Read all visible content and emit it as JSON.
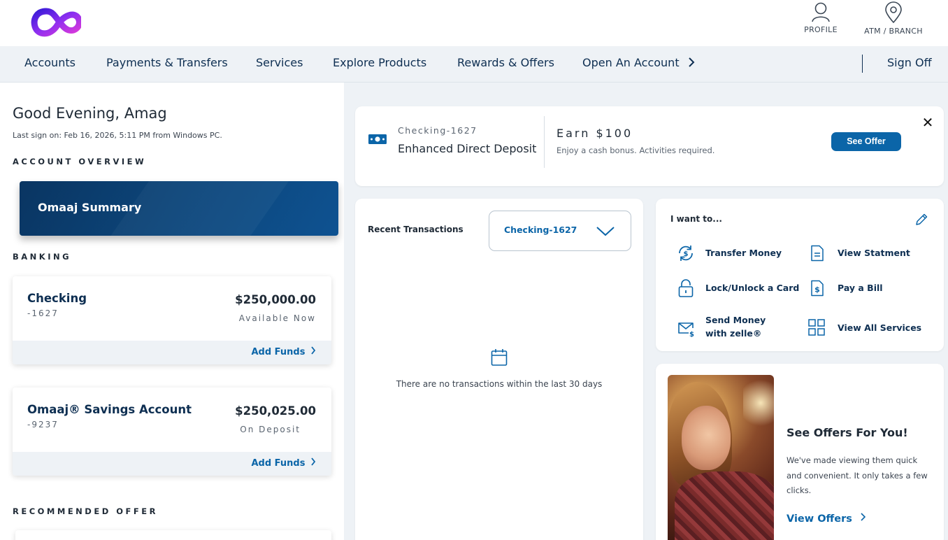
{
  "header": {
    "profile_label": "PROFILE",
    "atm_label": "ATM / BRANCH"
  },
  "nav": {
    "items": [
      "Accounts",
      "Payments & Transfers",
      "Services",
      "Explore Products",
      "Rewards & Offers",
      "Open An Account"
    ],
    "sign_off": "Sign Off"
  },
  "overview": {
    "greeting": "Good Evening, Amag",
    "last_sign_on": "Last sign on: Feb 16, 2026, 5:11 PM from Windows PC.",
    "section_title": "ACCOUNT OVERVIEW",
    "summary_title": "Omaaj Summary",
    "banking_title": "BANKING",
    "accounts": [
      {
        "name": "Checking",
        "number": "-1627",
        "balance": "$250,000.00",
        "status": "Available Now",
        "action": "Add Funds"
      },
      {
        "name": "Omaaj® Savings Account",
        "number": "-9237",
        "balance": "$250,025.00",
        "status": "On Deposit",
        "action": "Add Funds"
      }
    ],
    "recommended_title": "RECOMMENDED OFFER"
  },
  "promo": {
    "account": "Checking-1627",
    "title": "Enhanced Direct Deposit",
    "headline": "Earn $100",
    "description": "Enjoy a cash bonus. Activities required.",
    "button": "See Offer",
    "close": "✕"
  },
  "recent": {
    "title": "Recent Transactions",
    "selected_account": "Checking-1627",
    "empty_message": "There are no transactions within the last 30 days"
  },
  "want": {
    "title": "I want to...",
    "items": [
      "Transfer Money",
      "View Statment",
      "Lock/Unlock a Card",
      "Pay a Bill",
      "Send Money with zelle®",
      "View All Services"
    ]
  },
  "offers": {
    "title": "See Offers For You!",
    "text": "We've made viewing them quick and convenient. It only takes a few clicks.",
    "link": "View Offers"
  },
  "colors": {
    "brand_blue": "#0b65a8",
    "navy": "#0e2f52",
    "nav_bg": "#eef2f6",
    "logo_gradient_start": "#7b2ff7",
    "logo_gradient_end": "#e03ad8"
  },
  "icons": [
    "infinity-logo",
    "user-icon",
    "location-pin-icon",
    "chevron-right-icon",
    "cash-icon",
    "close-icon",
    "chevron-down-icon",
    "calendar-icon",
    "pencil-icon",
    "transfer-icon",
    "document-icon",
    "lock-icon",
    "bill-icon",
    "mail-dollar-icon",
    "grid-icon"
  ]
}
